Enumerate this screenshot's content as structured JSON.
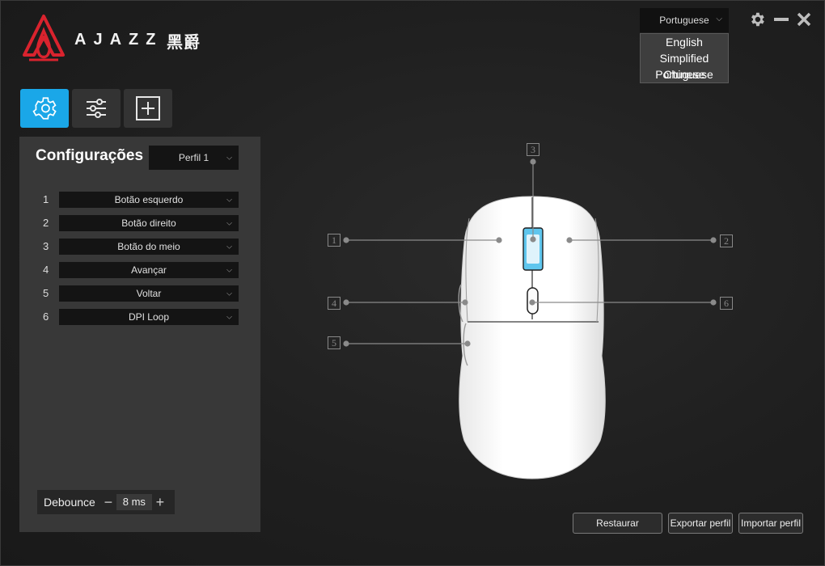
{
  "brand": {
    "name": "AJAZZ",
    "name_cn": "黑爵"
  },
  "language": {
    "selected": "Portuguese",
    "options": [
      "English",
      "Simplified Chinese",
      "Portuguese"
    ]
  },
  "window": {
    "settings_icon": "gear-icon",
    "minimize_icon": "minus-icon",
    "close_icon": "close-icon"
  },
  "tabs": [
    {
      "name": "settings",
      "icon": "gear-icon",
      "active": true
    },
    {
      "name": "adjust",
      "icon": "sliders-icon",
      "active": false
    },
    {
      "name": "macro",
      "icon": "plus-square-icon",
      "active": false
    }
  ],
  "panel": {
    "title": "Configurações",
    "profile": "Perfil 1",
    "buttons": [
      {
        "num": "1",
        "value": "Botão esquerdo"
      },
      {
        "num": "2",
        "value": "Botão direito"
      },
      {
        "num": "3",
        "value": "Botão do meio"
      },
      {
        "num": "4",
        "value": "Avançar"
      },
      {
        "num": "5",
        "value": "Voltar"
      },
      {
        "num": "6",
        "value": "DPI Loop"
      }
    ],
    "debounce": {
      "label": "Debounce",
      "value": "8 ms",
      "minus": "−",
      "plus": "+"
    }
  },
  "mouse_tags": [
    "1",
    "2",
    "3",
    "4",
    "5",
    "6"
  ],
  "actions": {
    "restore": "Restaurar",
    "export": "Exportar perfil",
    "import": "Importar perfil"
  },
  "colors": {
    "accent": "#1aa7e8",
    "logo_red": "#d9232e"
  }
}
